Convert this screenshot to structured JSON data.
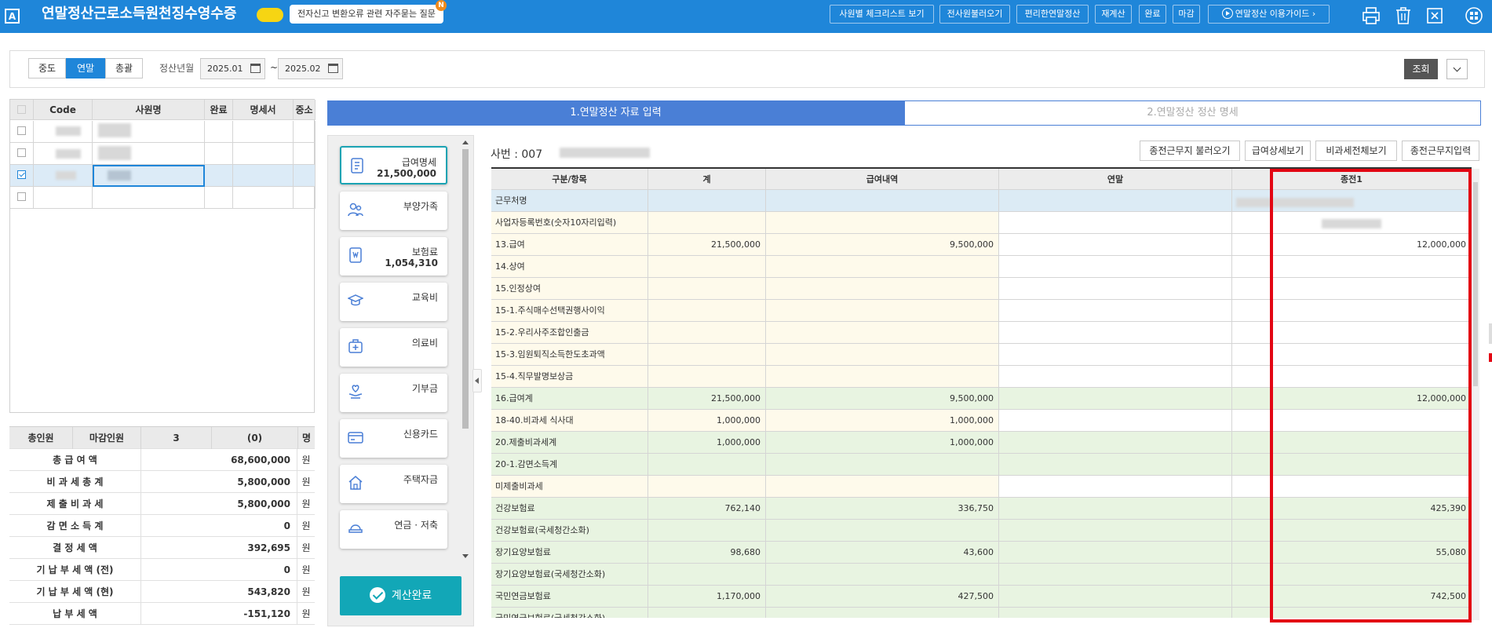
{
  "app": {
    "title": "연말정산근로소득원천징수영수증",
    "notice": "전자신고 변환오류 관련 자주묻는 질문",
    "notice_badge": "N",
    "logo": "A"
  },
  "toolbar": {
    "checklist": "사원별 체크리스트 보기",
    "load_all": "전사원불러오기",
    "easy_settlement": "편리한연말정산",
    "recalc": "재계산",
    "complete": "완료",
    "close": "마감",
    "guide": "연말정산 이용가이드 ›"
  },
  "filter": {
    "modes": [
      "중도",
      "연말",
      "총괄"
    ],
    "active_mode": "연말",
    "period_label": "정산년월",
    "from": "2025.01",
    "tilde": "~",
    "to": "2025.02",
    "search": "조회"
  },
  "employee_grid": {
    "headers": [
      "Code",
      "사원명",
      "완료",
      "명세서",
      "중소"
    ],
    "rows": [
      {
        "checked": false,
        "selected": false
      },
      {
        "checked": false,
        "selected": false
      },
      {
        "checked": true,
        "selected": true
      },
      {
        "checked": false,
        "selected": false
      }
    ]
  },
  "summary": {
    "header": {
      "total_label": "총인원",
      "closed_label": "마감인원",
      "count": "3",
      "closed": "(0)",
      "unit": "명"
    },
    "rows": [
      {
        "label": "총 급 여 액",
        "value": "68,600,000",
        "unit": "원"
      },
      {
        "label": "비 과 세 총 계",
        "value": "5,800,000",
        "unit": "원"
      },
      {
        "label": "제 출 비 과 세",
        "value": "5,800,000",
        "unit": "원"
      },
      {
        "label": "감 면 소 득 계",
        "value": "0",
        "unit": "원"
      },
      {
        "label": "결 정 세 액",
        "value": "392,695",
        "unit": "원"
      },
      {
        "label": "기 납 부 세 액 (전)",
        "value": "0",
        "unit": "원"
      },
      {
        "label": "기 납 부 세 액 (현)",
        "value": "543,820",
        "unit": "원"
      },
      {
        "label": "납 부 세 액",
        "value": "-151,120",
        "unit": "원"
      }
    ]
  },
  "tabs": {
    "input": "1.연말정산 자료 입력",
    "detail": "2.연말정산 정산 명세"
  },
  "categories": [
    {
      "label": "급여명세",
      "value": "21,500,000",
      "icon": "payslip-icon",
      "active": true
    },
    {
      "label": "부양가족",
      "value": "",
      "icon": "family-icon",
      "active": false
    },
    {
      "label": "보험료",
      "value": "1,054,310",
      "icon": "insurance-icon",
      "active": false
    },
    {
      "label": "교육비",
      "value": "",
      "icon": "education-icon",
      "active": false
    },
    {
      "label": "의료비",
      "value": "",
      "icon": "medical-icon",
      "active": false
    },
    {
      "label": "기부금",
      "value": "",
      "icon": "donation-icon",
      "active": false
    },
    {
      "label": "신용카드",
      "value": "",
      "icon": "credit-card-icon",
      "active": false
    },
    {
      "label": "주택자금",
      "value": "",
      "icon": "house-icon",
      "active": false
    },
    {
      "label": "연금 · 저축",
      "value": "",
      "icon": "pension-icon",
      "active": false
    }
  ],
  "calc_button": "계산완료",
  "detail": {
    "employee_label": "사번 : 007",
    "actions": [
      "종전근무지 불러오기",
      "급여상세보기",
      "비과세전체보기",
      "종전근무지입력"
    ],
    "headers": [
      "구분/항목",
      "계",
      "급여내역",
      "연말",
      "종전1"
    ],
    "rows": [
      {
        "label": "근무처명",
        "total": "",
        "pay": "",
        "year_end": "",
        "prev": ""
      },
      {
        "label": "사업자등록번호(숫자10자리입력)",
        "total": "",
        "pay": "",
        "year_end": "",
        "prev": ""
      },
      {
        "label": "13.급여",
        "total": "21,500,000",
        "pay": "9,500,000",
        "year_end": "",
        "prev": "12,000,000"
      },
      {
        "label": "14.상여",
        "total": "",
        "pay": "",
        "year_end": "",
        "prev": ""
      },
      {
        "label": "15.인정상여",
        "total": "",
        "pay": "",
        "year_end": "",
        "prev": ""
      },
      {
        "label": "15-1.주식매수선택권행사이익",
        "total": "",
        "pay": "",
        "year_end": "",
        "prev": ""
      },
      {
        "label": "15-2.우리사주조합인출금",
        "total": "",
        "pay": "",
        "year_end": "",
        "prev": ""
      },
      {
        "label": "15-3.임원퇴직소득한도초과액",
        "total": "",
        "pay": "",
        "year_end": "",
        "prev": ""
      },
      {
        "label": "15-4.직무발명보상금",
        "total": "",
        "pay": "",
        "year_end": "",
        "prev": ""
      },
      {
        "label": "16.급여계",
        "total": "21,500,000",
        "pay": "9,500,000",
        "year_end": "",
        "prev": "12,000,000"
      },
      {
        "label": "18-40.비과세 식사대",
        "total": "1,000,000",
        "pay": "1,000,000",
        "year_end": "",
        "prev": ""
      },
      {
        "label": "20.제출비과세계",
        "total": "1,000,000",
        "pay": "1,000,000",
        "year_end": "",
        "prev": ""
      },
      {
        "label": "20-1.감면소득계",
        "total": "",
        "pay": "",
        "year_end": "",
        "prev": ""
      },
      {
        "label": "미제출비과세",
        "total": "",
        "pay": "",
        "year_end": "",
        "prev": ""
      },
      {
        "label": "건강보험료",
        "total": "762,140",
        "pay": "336,750",
        "year_end": "",
        "prev": "425,390"
      },
      {
        "label": "건강보험료(국세청간소화)",
        "total": "",
        "pay": "",
        "year_end": "",
        "prev": ""
      },
      {
        "label": "장기요양보험료",
        "total": "98,680",
        "pay": "43,600",
        "year_end": "",
        "prev": "55,080"
      },
      {
        "label": "장기요양보험료(국세청간소화)",
        "total": "",
        "pay": "",
        "year_end": "",
        "prev": ""
      },
      {
        "label": "국민연금보험료",
        "total": "1,170,000",
        "pay": "427,500",
        "year_end": "",
        "prev": "742,500"
      },
      {
        "label": "국민연금보험료(국세청간소화)",
        "total": "",
        "pay": "",
        "year_end": "",
        "prev": ""
      }
    ]
  },
  "colors": {
    "topbar": "#1f86d9",
    "tab_active": "#4a7fd6",
    "calc": "#12a7b7",
    "highlight": "#e30613",
    "row_yellow": "#fefaeb",
    "row_green": "#e8f4e1",
    "row_blue": "#dcebf5"
  }
}
